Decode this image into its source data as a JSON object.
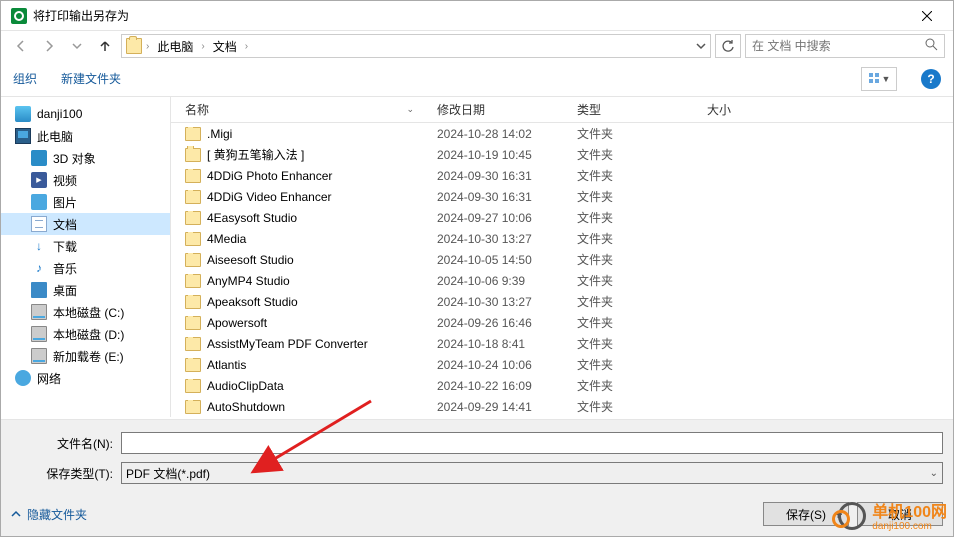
{
  "title": "将打印输出另存为",
  "breadcrumbs": [
    "此电脑",
    "文档"
  ],
  "search_placeholder": "在 文档 中搜索",
  "toolbar": {
    "organize": "组织",
    "new_folder": "新建文件夹"
  },
  "sidebar": [
    {
      "label": "danji100",
      "icon": "user",
      "sub": false
    },
    {
      "label": "此电脑",
      "icon": "pc",
      "sub": false
    },
    {
      "label": "3D 对象",
      "icon": "3d",
      "sub": true
    },
    {
      "label": "视频",
      "icon": "video",
      "sub": true
    },
    {
      "label": "图片",
      "icon": "pic",
      "sub": true
    },
    {
      "label": "文档",
      "icon": "doc",
      "sub": true,
      "sel": true
    },
    {
      "label": "下载",
      "icon": "dl",
      "sub": true
    },
    {
      "label": "音乐",
      "icon": "music",
      "sub": true
    },
    {
      "label": "桌面",
      "icon": "desk",
      "sub": true
    },
    {
      "label": "本地磁盘 (C:)",
      "icon": "disk",
      "sub": true
    },
    {
      "label": "本地磁盘 (D:)",
      "icon": "disk",
      "sub": true
    },
    {
      "label": "新加载卷 (E:)",
      "icon": "disk",
      "sub": true
    },
    {
      "label": "网络",
      "icon": "net",
      "sub": false
    }
  ],
  "columns": {
    "name": "名称",
    "date": "修改日期",
    "type": "类型",
    "size": "大小"
  },
  "files": [
    {
      "name": ".Migi",
      "date": "2024-10-28 14:02",
      "type": "文件夹"
    },
    {
      "name": "[ 黄狗五笔输入法 ]",
      "date": "2024-10-19 10:45",
      "type": "文件夹"
    },
    {
      "name": "4DDiG Photo Enhancer",
      "date": "2024-09-30 16:31",
      "type": "文件夹"
    },
    {
      "name": "4DDiG Video Enhancer",
      "date": "2024-09-30 16:31",
      "type": "文件夹"
    },
    {
      "name": "4Easysoft Studio",
      "date": "2024-09-27 10:06",
      "type": "文件夹"
    },
    {
      "name": "4Media",
      "date": "2024-10-30 13:27",
      "type": "文件夹"
    },
    {
      "name": "Aiseesoft Studio",
      "date": "2024-10-05 14:50",
      "type": "文件夹"
    },
    {
      "name": "AnyMP4 Studio",
      "date": "2024-10-06 9:39",
      "type": "文件夹"
    },
    {
      "name": "Apeaksoft Studio",
      "date": "2024-10-30 13:27",
      "type": "文件夹"
    },
    {
      "name": "Apowersoft",
      "date": "2024-09-26 16:46",
      "type": "文件夹"
    },
    {
      "name": "AssistMyTeam PDF Converter",
      "date": "2024-10-18 8:41",
      "type": "文件夹"
    },
    {
      "name": "Atlantis",
      "date": "2024-10-24 10:06",
      "type": "文件夹"
    },
    {
      "name": "AudioClipData",
      "date": "2024-10-22 16:09",
      "type": "文件夹"
    },
    {
      "name": "AutoShutdown",
      "date": "2024-09-29 14:41",
      "type": "文件夹"
    }
  ],
  "form": {
    "filename_label": "文件名(N):",
    "filename_value": "",
    "filetype_label": "保存类型(T):",
    "filetype_value": "PDF 文档(*.pdf)"
  },
  "actions": {
    "hide_folders": "隐藏文件夹",
    "save": "保存(S)",
    "cancel": "取消"
  },
  "watermark": {
    "cn": "单机100网",
    "en": "danji100.com"
  }
}
